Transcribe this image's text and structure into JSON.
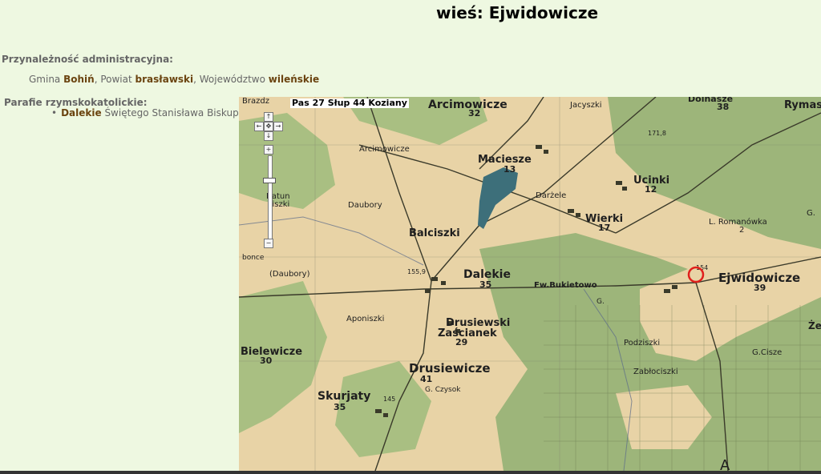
{
  "page": {
    "title": "wieś: Ejwidowicze"
  },
  "admin": {
    "label": "Przynależność administracyjna:",
    "gmina_prefix": "Gmina ",
    "gmina": "Bohiń",
    "sep1": ", Powiat ",
    "powiat": "brasławski",
    "sep2": ", Województwo ",
    "wojewodztwo": "wileńskie"
  },
  "parishes": {
    "label": "Parafie rzymskokatolickie:",
    "items": [
      {
        "name": "Dalekie",
        "dedication": " Świętego Stanisława Biskupa"
      }
    ]
  },
  "map": {
    "sheet_label": "Pas 27 Słup 44  Koziany",
    "place_labels": {
      "arcimowicze": "Arcimowicze",
      "arcimowicze_num": "32",
      "dolnasze_num": "38",
      "jacyszki": "Jacyszki",
      "rymasze": "Rymas",
      "arcimowicze_small": "Arcimowicze",
      "maciesze": "Maciesze",
      "maciesze_num": "13",
      "darzele": "Darżele",
      "ucinki": "Ucinki",
      "ucinki_num": "12",
      "batun": "Batun",
      "ciszki": "ciszki",
      "daubory": "Daubory",
      "balciszki": "Balciszki",
      "wierki": "Wierki",
      "wierki_num": "17",
      "romanowka": "L. Romanówka",
      "romanowka_num": "2",
      "dalekie": "Dalekie",
      "dalekie_num": "35",
      "fw_bukietowo": "Fw.Bukietowo",
      "ejwidowicze": "Ejwidowicze",
      "ejwidowicze_num": "39",
      "daubory2": "(Daubory)",
      "aponiszki": "Aponiszki",
      "drusiewski": "Drusiewski",
      "zascianek": "Zaścianek",
      "zascianek_num": "29",
      "podziszki": "Podziszki",
      "gcisze": "G.Cisze",
      "bielewicze": "Bielewicze",
      "bielewicze_num": "30",
      "drusiewicze": "Drusiewicze",
      "drusiewicze_num": "41",
      "zabloc": "Zabłociszki",
      "gczysok": "G. Czysok",
      "skurjaty": "Skurjaty",
      "skurjaty_num": "35",
      "height_154": "154",
      "height_155": "155,9",
      "height_145": "145",
      "height_717": "171,8",
      "brazdz": "Brazdz",
      "bonce": "bonce",
      "ze": "Że",
      "g_small": "G.",
      "g2": "G.",
      "dolnasze": "Dolnasze",
      "a_letter": "A"
    },
    "colors": {
      "paper": "#e8d3a6",
      "forest": "#9db57a",
      "water": "#3d6f7a",
      "marker": "#e0201c"
    }
  }
}
